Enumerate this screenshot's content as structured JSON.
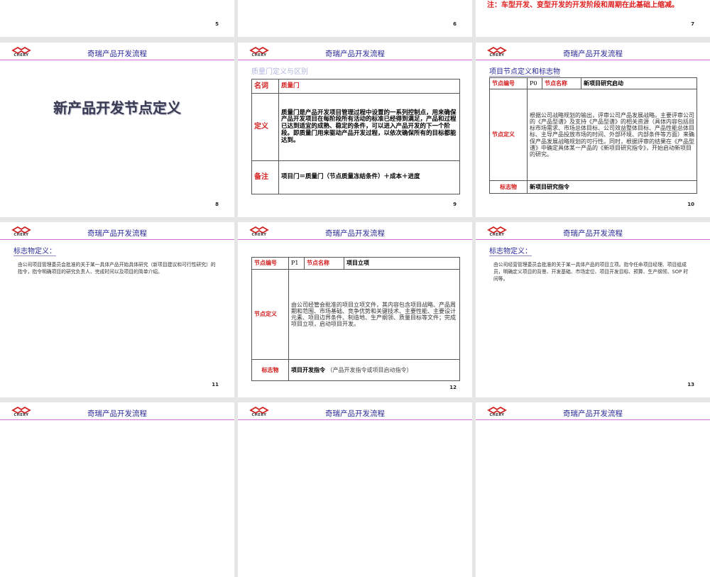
{
  "common": {
    "header_title": "奇瑞产品开发流程",
    "logo_text": "CHERY"
  },
  "slides": {
    "s5": {
      "num": "5"
    },
    "s6": {
      "num": "6"
    },
    "s7": {
      "num": "7",
      "note": "注：车型开发、变型开发的开发阶段和周期在此基础上缩减。"
    },
    "s8": {
      "num": "8",
      "title": "新产品开发节点定义"
    },
    "s9": {
      "num": "9",
      "subtitle": "质量门定义与区别",
      "rows": [
        {
          "label": "名词",
          "value": "质量门"
        },
        {
          "label": "定义",
          "value": "质量门是产品开发项目管理过程中设置的一系列控制点，用来确保产品开发项目在每阶段所有活动的标准已经得到满足，产品和过程已达到适宜的成熟、稳定的条件，可以进入产品开发的下一个阶段。即质量门用来驱动产品开发过程，以依次确保所有的目标都能达到。"
        },
        {
          "label": "备注",
          "value": "项目门＝质量门（节点质量冻结条件）＋成本＋进度"
        }
      ]
    },
    "s10": {
      "num": "10",
      "subtitle": "项目节点定义和标志物",
      "id_label": "节点编号",
      "id": "P0",
      "name_label": "节点名称",
      "name": "新项目研究启动",
      "def_label": "节点定义",
      "def": "根据公司战略规划的输出，评审公司产品发展战略。主要评审公司的《产品型谱》及支持《产品型谱》的相关资源（具体内容包括目标市场需求、市场总体目标、公司效益整体目标、产品性能总体目标、主导产品投放市场的时间、外部环境、内部条件等方面）来确保产品发展战略规划的可行性。同时，根据评审的结果在《产品型谱》中确定具体某一产品的《新项目研究指令》，开始启动新项目的研究。",
      "mark_label": "标志物",
      "mark": "新项目研究指令"
    },
    "s11": {
      "num": "11",
      "subtitle": "标志物定义：",
      "body": "由公司项目管理委员会批准的关于某一具体产品开始具体研究（新项目建议和可行性研究）的指令，指令明确项目的研究负责人、完成时间以及项目的简单介绍。"
    },
    "s12": {
      "num": "12",
      "id_label": "节点编号",
      "id": "P1",
      "name_label": "节点名称",
      "name": "项目立项",
      "def_label": "节点定义",
      "def": "由公司经管会批准的项目立项文件，其内容包含项目战略、产品周期和范围、市场基础、竞争优势和关键技术、主要性能、主要设计元素、项目边界条件、制造地、生产纲领、质量目标等文件；完成项目立项，启动项目开发。",
      "mark_label": "标志物",
      "mark": "项目开发指令",
      "mark_extra": "（产品开发指令或项目启动指令）"
    },
    "s13": {
      "num": "13",
      "subtitle": "标志物定义：",
      "body": "由公司经营管理委员会批准的关于某一具体产品的项目立项。指令任命项目经理、项目组成员，明确定义项目的背景、开发基础、市场定位、项目开发目标、预算、生产纲领、SOP 时间等。"
    }
  }
}
